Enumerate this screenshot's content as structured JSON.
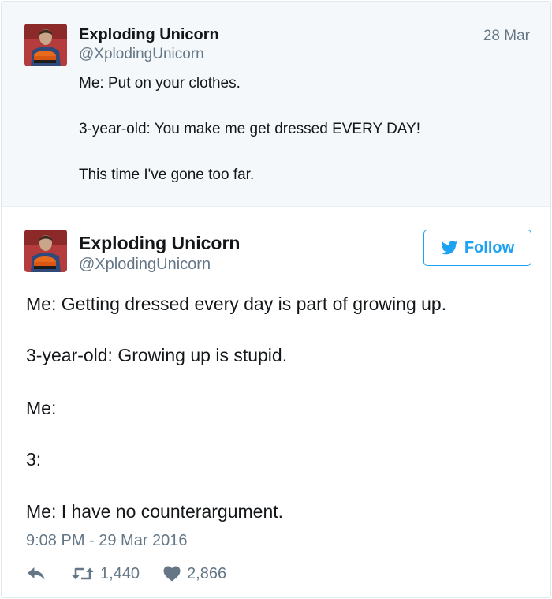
{
  "parent_tweet": {
    "author_name": "Exploding Unicorn",
    "author_handle": "@XplodingUnicorn",
    "date": "28 Mar",
    "lines": [
      "Me: Put on your clothes.",
      "3-year-old: You make me get dressed EVERY DAY!",
      "This time I've gone too far."
    ]
  },
  "tweet": {
    "author_name": "Exploding Unicorn",
    "author_handle": "@XplodingUnicorn",
    "follow_label": "Follow",
    "lines": [
      "Me: Getting dressed every day is part of growing up.",
      "3-year-old: Growing up is stupid.",
      "Me:",
      "3:",
      "Me: I have no counterargument."
    ],
    "timestamp": "9:08 PM - 29 Mar 2016",
    "retweets": "1,440",
    "likes": "2,866"
  },
  "icons": {
    "reply": "reply-icon",
    "retweet": "retweet-icon",
    "like": "heart-icon",
    "bird": "twitter-bird-icon"
  },
  "colors": {
    "accent": "#1da1f2",
    "muted": "#657786",
    "action_icon": "#657786",
    "parent_bg": "#f5f8fa"
  }
}
